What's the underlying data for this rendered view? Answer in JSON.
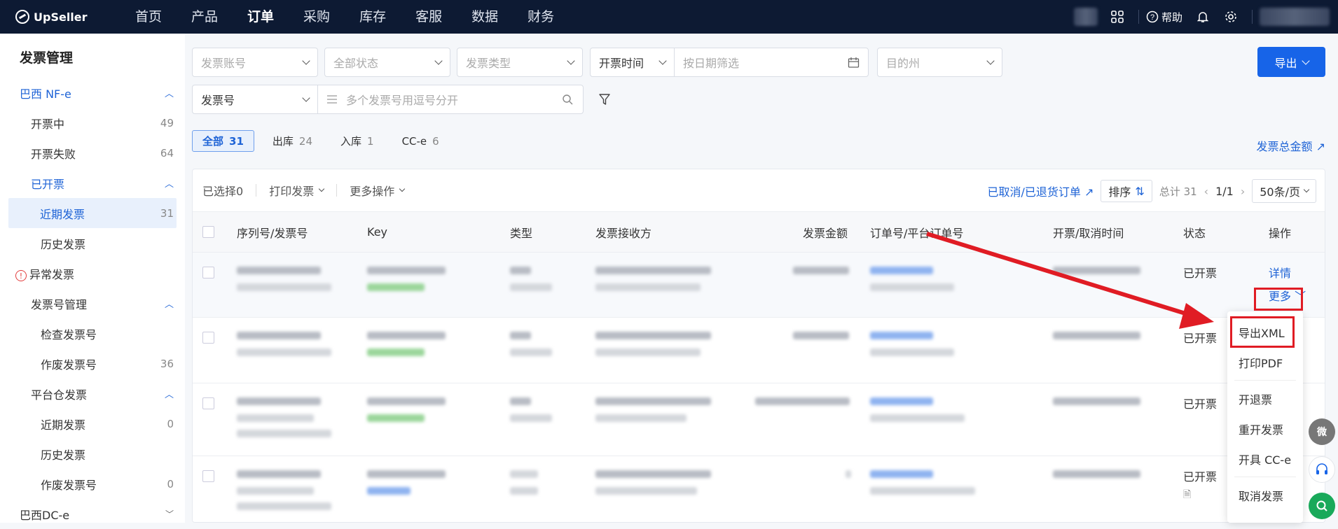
{
  "app": {
    "name": "UpSeller"
  },
  "nav": [
    {
      "label": "首页"
    },
    {
      "label": "产品"
    },
    {
      "label": "订单",
      "active": true
    },
    {
      "label": "采购"
    },
    {
      "label": "库存"
    },
    {
      "label": "客服"
    },
    {
      "label": "数据"
    },
    {
      "label": "财务"
    }
  ],
  "top_right": {
    "help_label": "帮助"
  },
  "sidebar": {
    "title": "发票管理",
    "group1": "巴西 NF-e",
    "issuing": {
      "label": "开票中",
      "count": "49"
    },
    "failed": {
      "label": "开票失败",
      "count": "64"
    },
    "issued": "已开票",
    "recent": {
      "label": "近期发票",
      "count": "31"
    },
    "history": "历史发票",
    "abnormal": "异常发票",
    "num_mgmt": "发票号管理",
    "check_num": "检查发票号",
    "void_num": {
      "label": "作废发票号",
      "count": "36"
    },
    "platform": "平台仓发票",
    "p_recent": {
      "label": "近期发票",
      "count": "0"
    },
    "p_history": "历史发票",
    "p_void": {
      "label": "作废发票号",
      "count": "0"
    },
    "dc": "巴西DC-e"
  },
  "filters": {
    "account": "发票账号",
    "status": "全部状态",
    "type": "发票类型",
    "time": "开票时间",
    "date_ph": "按日期筛选",
    "dest": "目的州",
    "num_type": "发票号",
    "num_ph": "多个发票号用逗号分开",
    "export": "导出"
  },
  "tabs": [
    {
      "label": "全部",
      "count": "31"
    },
    {
      "label": "出库",
      "count": "24"
    },
    {
      "label": "入库",
      "count": "1"
    },
    {
      "label": "CC-e",
      "count": "6"
    }
  ],
  "total_amount_link": "发票总金额",
  "toolbar": {
    "selected": "已选择0",
    "print": "打印发票",
    "more_ops": "更多操作",
    "cancelled_link": "已取消/已退货订单",
    "sort": "排序",
    "total": "总计 31",
    "page": "1/1",
    "per_page": "50条/页"
  },
  "columns": [
    "序列号/发票号",
    "Key",
    "类型",
    "发票接收方",
    "发票金额",
    "订单号/平台订单号",
    "开票/取消时间",
    "状态",
    "操作"
  ],
  "rows": [
    {
      "status": "已开票",
      "action1": "详情",
      "action2": "更多"
    },
    {
      "status": "已开票"
    },
    {
      "status": "已开票"
    },
    {
      "status": "已开票"
    }
  ],
  "more_menu": [
    "导出XML",
    "打印PDF",
    "开退票",
    "重开发票",
    "开具 CC-e",
    "取消发票"
  ],
  "float": {
    "wechat": "微"
  },
  "colors": {
    "accent": "#1764e8",
    "highlight": "#e01c24",
    "topbar": "#0d1a33"
  }
}
